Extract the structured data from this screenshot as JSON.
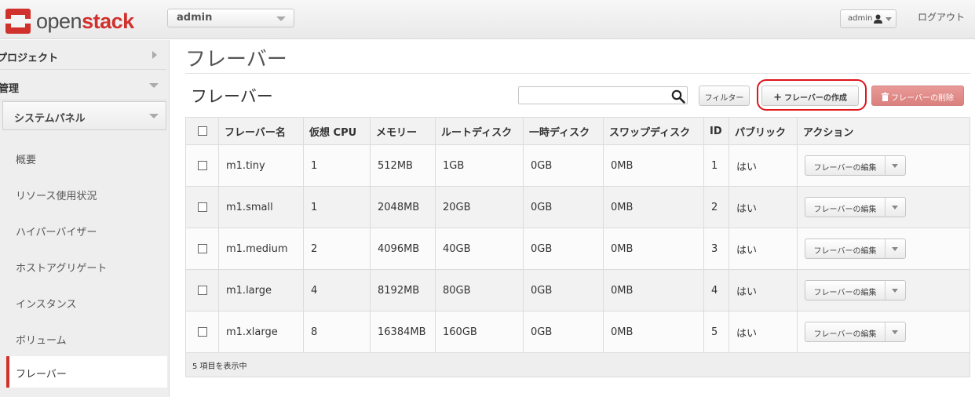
{
  "brand": {
    "word1": "open",
    "word2": "stack"
  },
  "header": {
    "project": "admin",
    "user": "admin",
    "logout": "ログアウト"
  },
  "sidebar": {
    "sections": [
      {
        "label": "プロジェクト"
      },
      {
        "label": "管理"
      }
    ],
    "panel": "システムパネル",
    "items": [
      {
        "label": "概要"
      },
      {
        "label": "リソース使用状況"
      },
      {
        "label": "ハイパーバイザー"
      },
      {
        "label": "ホストアグリゲート"
      },
      {
        "label": "インスタンス"
      },
      {
        "label": "ボリューム"
      },
      {
        "label": "フレーバー"
      }
    ]
  },
  "main": {
    "page_title": "フレーバー",
    "table_title": "フレーバー",
    "search_placeholder": "",
    "filter_label": "フィルター",
    "create_label": "フレーバーの作成",
    "delete_label": "フレーバーの削除"
  },
  "table": {
    "columns": [
      "フレーバー名",
      "仮想 CPU",
      "メモリー",
      "ルートディスク",
      "一時ディスク",
      "スワップディスク",
      "ID",
      "パブリック",
      "アクション"
    ],
    "rows": [
      {
        "name": "m1.tiny",
        "vcpu": "1",
        "memory": "512MB",
        "root": "1GB",
        "ephemeral": "0GB",
        "swap": "0MB",
        "id": "1",
        "public": "はい",
        "action": "フレーバーの編集"
      },
      {
        "name": "m1.small",
        "vcpu": "1",
        "memory": "2048MB",
        "root": "20GB",
        "ephemeral": "0GB",
        "swap": "0MB",
        "id": "2",
        "public": "はい",
        "action": "フレーバーの編集"
      },
      {
        "name": "m1.medium",
        "vcpu": "2",
        "memory": "4096MB",
        "root": "40GB",
        "ephemeral": "0GB",
        "swap": "0MB",
        "id": "3",
        "public": "はい",
        "action": "フレーバーの編集"
      },
      {
        "name": "m1.large",
        "vcpu": "4",
        "memory": "8192MB",
        "root": "80GB",
        "ephemeral": "0GB",
        "swap": "0MB",
        "id": "4",
        "public": "はい",
        "action": "フレーバーの編集"
      },
      {
        "name": "m1.xlarge",
        "vcpu": "8",
        "memory": "16384MB",
        "root": "160GB",
        "ephemeral": "0GB",
        "swap": "0MB",
        "id": "5",
        "public": "はい",
        "action": "フレーバーの編集"
      }
    ],
    "footer": "5 項目を表示中"
  },
  "colors": {
    "accent": "#d0312d",
    "highlight": "#e0141b",
    "danger_button": "#d9807d"
  }
}
